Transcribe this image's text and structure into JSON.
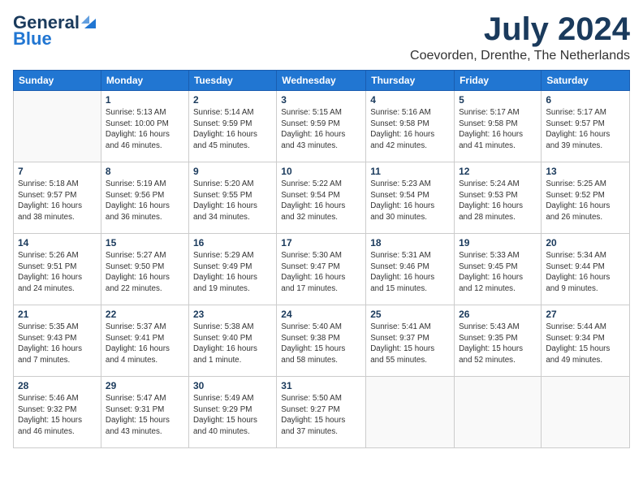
{
  "header": {
    "logo_line1": "General",
    "logo_line2": "Blue",
    "month": "July 2024",
    "location": "Coevorden, Drenthe, The Netherlands"
  },
  "weekdays": [
    "Sunday",
    "Monday",
    "Tuesday",
    "Wednesday",
    "Thursday",
    "Friday",
    "Saturday"
  ],
  "weeks": [
    [
      {
        "day": "",
        "info": ""
      },
      {
        "day": "1",
        "info": "Sunrise: 5:13 AM\nSunset: 10:00 PM\nDaylight: 16 hours\nand 46 minutes."
      },
      {
        "day": "2",
        "info": "Sunrise: 5:14 AM\nSunset: 9:59 PM\nDaylight: 16 hours\nand 45 minutes."
      },
      {
        "day": "3",
        "info": "Sunrise: 5:15 AM\nSunset: 9:59 PM\nDaylight: 16 hours\nand 43 minutes."
      },
      {
        "day": "4",
        "info": "Sunrise: 5:16 AM\nSunset: 9:58 PM\nDaylight: 16 hours\nand 42 minutes."
      },
      {
        "day": "5",
        "info": "Sunrise: 5:17 AM\nSunset: 9:58 PM\nDaylight: 16 hours\nand 41 minutes."
      },
      {
        "day": "6",
        "info": "Sunrise: 5:17 AM\nSunset: 9:57 PM\nDaylight: 16 hours\nand 39 minutes."
      }
    ],
    [
      {
        "day": "7",
        "info": "Sunrise: 5:18 AM\nSunset: 9:57 PM\nDaylight: 16 hours\nand 38 minutes."
      },
      {
        "day": "8",
        "info": "Sunrise: 5:19 AM\nSunset: 9:56 PM\nDaylight: 16 hours\nand 36 minutes."
      },
      {
        "day": "9",
        "info": "Sunrise: 5:20 AM\nSunset: 9:55 PM\nDaylight: 16 hours\nand 34 minutes."
      },
      {
        "day": "10",
        "info": "Sunrise: 5:22 AM\nSunset: 9:54 PM\nDaylight: 16 hours\nand 32 minutes."
      },
      {
        "day": "11",
        "info": "Sunrise: 5:23 AM\nSunset: 9:54 PM\nDaylight: 16 hours\nand 30 minutes."
      },
      {
        "day": "12",
        "info": "Sunrise: 5:24 AM\nSunset: 9:53 PM\nDaylight: 16 hours\nand 28 minutes."
      },
      {
        "day": "13",
        "info": "Sunrise: 5:25 AM\nSunset: 9:52 PM\nDaylight: 16 hours\nand 26 minutes."
      }
    ],
    [
      {
        "day": "14",
        "info": "Sunrise: 5:26 AM\nSunset: 9:51 PM\nDaylight: 16 hours\nand 24 minutes."
      },
      {
        "day": "15",
        "info": "Sunrise: 5:27 AM\nSunset: 9:50 PM\nDaylight: 16 hours\nand 22 minutes."
      },
      {
        "day": "16",
        "info": "Sunrise: 5:29 AM\nSunset: 9:49 PM\nDaylight: 16 hours\nand 19 minutes."
      },
      {
        "day": "17",
        "info": "Sunrise: 5:30 AM\nSunset: 9:47 PM\nDaylight: 16 hours\nand 17 minutes."
      },
      {
        "day": "18",
        "info": "Sunrise: 5:31 AM\nSunset: 9:46 PM\nDaylight: 16 hours\nand 15 minutes."
      },
      {
        "day": "19",
        "info": "Sunrise: 5:33 AM\nSunset: 9:45 PM\nDaylight: 16 hours\nand 12 minutes."
      },
      {
        "day": "20",
        "info": "Sunrise: 5:34 AM\nSunset: 9:44 PM\nDaylight: 16 hours\nand 9 minutes."
      }
    ],
    [
      {
        "day": "21",
        "info": "Sunrise: 5:35 AM\nSunset: 9:43 PM\nDaylight: 16 hours\nand 7 minutes."
      },
      {
        "day": "22",
        "info": "Sunrise: 5:37 AM\nSunset: 9:41 PM\nDaylight: 16 hours\nand 4 minutes."
      },
      {
        "day": "23",
        "info": "Sunrise: 5:38 AM\nSunset: 9:40 PM\nDaylight: 16 hours\nand 1 minute."
      },
      {
        "day": "24",
        "info": "Sunrise: 5:40 AM\nSunset: 9:38 PM\nDaylight: 15 hours\nand 58 minutes."
      },
      {
        "day": "25",
        "info": "Sunrise: 5:41 AM\nSunset: 9:37 PM\nDaylight: 15 hours\nand 55 minutes."
      },
      {
        "day": "26",
        "info": "Sunrise: 5:43 AM\nSunset: 9:35 PM\nDaylight: 15 hours\nand 52 minutes."
      },
      {
        "day": "27",
        "info": "Sunrise: 5:44 AM\nSunset: 9:34 PM\nDaylight: 15 hours\nand 49 minutes."
      }
    ],
    [
      {
        "day": "28",
        "info": "Sunrise: 5:46 AM\nSunset: 9:32 PM\nDaylight: 15 hours\nand 46 minutes."
      },
      {
        "day": "29",
        "info": "Sunrise: 5:47 AM\nSunset: 9:31 PM\nDaylight: 15 hours\nand 43 minutes."
      },
      {
        "day": "30",
        "info": "Sunrise: 5:49 AM\nSunset: 9:29 PM\nDaylight: 15 hours\nand 40 minutes."
      },
      {
        "day": "31",
        "info": "Sunrise: 5:50 AM\nSunset: 9:27 PM\nDaylight: 15 hours\nand 37 minutes."
      },
      {
        "day": "",
        "info": ""
      },
      {
        "day": "",
        "info": ""
      },
      {
        "day": "",
        "info": ""
      }
    ]
  ]
}
